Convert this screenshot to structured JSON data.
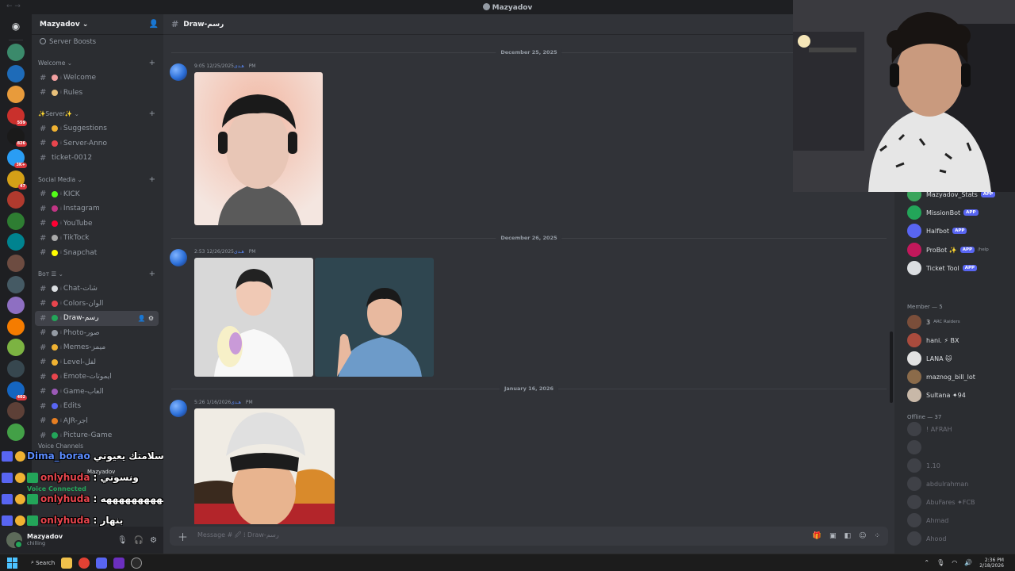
{
  "window": {
    "title": "Mazyadov"
  },
  "server": {
    "name": "Mazyadov",
    "boosts_label": "Server Boosts"
  },
  "server_badges": [
    "559",
    "826",
    "3K+",
    "47",
    "402"
  ],
  "categories": [
    {
      "label": "Welcome",
      "channels": [
        {
          "name": "Welcome",
          "emoji_color": "#f2a0a0"
        },
        {
          "name": "Rules",
          "emoji_color": "#e8c07a"
        }
      ]
    },
    {
      "label": "✨Server✨",
      "channels": [
        {
          "name": "Suggestions",
          "emoji_color": "#f0b232"
        },
        {
          "name": "Server-Anno",
          "emoji_color": "#e8454d"
        },
        {
          "name": "ticket-0012",
          "emoji_color": ""
        }
      ]
    },
    {
      "label": "Social Media",
      "channels": [
        {
          "name": "KICK",
          "emoji_color": "#53fc18"
        },
        {
          "name": "Instagram",
          "emoji_color": "#c13584"
        },
        {
          "name": "YouTube",
          "emoji_color": "#ff0033"
        },
        {
          "name": "TikTock",
          "emoji_color": "#aaaaaa"
        },
        {
          "name": "Snapchat",
          "emoji_color": "#fffc00"
        }
      ]
    },
    {
      "label": "Вот ☰",
      "channels": [
        {
          "name": "Chat-شات",
          "emoji_color": "#dbdee1"
        },
        {
          "name": "Colors-الوان",
          "emoji_color": "#e8454d"
        },
        {
          "name": "Draw-رسم",
          "emoji_color": "#23a559",
          "active": true
        },
        {
          "name": "Photo-صور",
          "emoji_color": "#949ba4"
        },
        {
          "name": "Memes-ميمز",
          "emoji_color": "#f0b232"
        },
        {
          "name": "Level-لفل",
          "emoji_color": "#f0b232"
        },
        {
          "name": "Emote-ايموتات",
          "emoji_color": "#e8454d"
        },
        {
          "name": "Game-العاب",
          "emoji_color": "#9b59b6"
        },
        {
          "name": "Edits",
          "emoji_color": "#5865f2"
        },
        {
          "name": "AJR-اجر",
          "emoji_color": "#e67e22"
        },
        {
          "name": "Picture-Game",
          "emoji_color": "#23a559"
        }
      ]
    }
  ],
  "voice": {
    "category_label": "Voice Channels",
    "user": "Mazyadov",
    "connected_label": "Voice Connected"
  },
  "overlay_chat": [
    {
      "name": "Dima_borao",
      "msg": "سلامتك يعيوني",
      "name_color": "blue"
    },
    {
      "name": "onlyhuda",
      "msg": ": ونسوني",
      "name_color": "red"
    },
    {
      "name": "onlyhuda",
      "msg": ": ههههههههههههههه",
      "name_color": "red"
    },
    {
      "name": "onlyhuda",
      "msg": ": بنهار",
      "name_color": "red"
    }
  ],
  "user_panel": {
    "name": "Mazyadov",
    "status": "chilling"
  },
  "channel": {
    "header": "Draw-رسم",
    "composer_placeholder": "Message # 🖉 ⁞ Draw-رسم"
  },
  "messages": [
    {
      "date_divider": "December 25, 2025",
      "author": "هـدى",
      "timestamp": "12/25/2025 9:05 PM"
    },
    {
      "date_divider": "December 26, 2025",
      "author": "هـدى",
      "timestamp": "12/26/2025 2:53 PM"
    },
    {
      "date_divider": "January 16, 2026",
      "author": "هـدى",
      "timestamp": "1/16/2026 5:26 PM"
    }
  ],
  "members": {
    "bots": [
      {
        "name": "Mazyadov_Stats",
        "tag": "APP",
        "color": "#3ba55c"
      },
      {
        "name": "MissionBot",
        "tag": "APP",
        "color": "#23a559"
      },
      {
        "name": "Halfbot",
        "tag": "APP",
        "color": "#5865f2"
      },
      {
        "name": "ProBot ✨",
        "tag": "APP",
        "sub": "/help",
        "color": "#c2185b"
      },
      {
        "name": "Ticket Tool",
        "tag": "APP",
        "color": "#dbdee1"
      }
    ],
    "online_header": "Member — 5",
    "online": [
      {
        "name": "3",
        "sub": "ARC Raiders",
        "color": "#7a4e3a"
      },
      {
        "name": "hani. ⚡ BX",
        "sub": "",
        "color": "#a94b3d"
      },
      {
        "name": "LANA 🐱",
        "sub": "",
        "color": "#e2e2e2"
      },
      {
        "name": "maznog_bill_lot",
        "sub": "",
        "color": "#8b6b4a"
      },
      {
        "name": "Sultana ✦94",
        "sub": "",
        "color": "#c8b8a8"
      }
    ],
    "offline_header": "Offline — 37",
    "offline": [
      "! AFRAH",
      "",
      "1.10",
      "abdulrahman",
      "AbuFares ✦FCB",
      "Ahmad",
      "Ahood"
    ]
  },
  "taskbar": {
    "search_label": "Search",
    "time": "2:36 PM",
    "date": "2/18/2026"
  }
}
